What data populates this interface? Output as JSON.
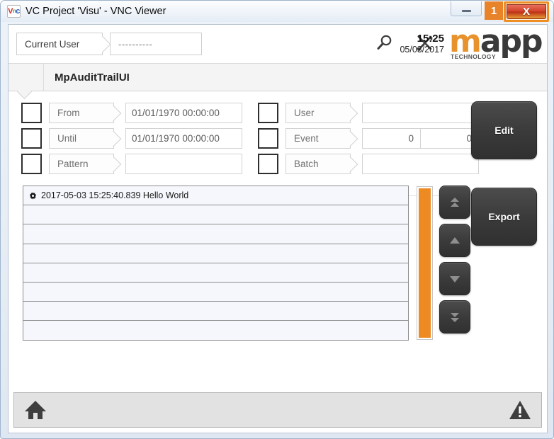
{
  "window": {
    "title": "VC Project 'Visu' - VNC Viewer",
    "logo_icon": "vnc-logo-icon",
    "logo_v": "V",
    "logo_n": "n",
    "logo_c": "c",
    "minimize_label": "minimize-icon",
    "badge_count": "1",
    "close_label": "X"
  },
  "header": {
    "current_user_label": "Current User",
    "current_user_value": "----------",
    "search_icon": "magnifier-icon",
    "tools_icon": "tools-icon",
    "time": "15:25",
    "date": "05/03/2017",
    "brand": {
      "m": "m",
      "app": "app",
      "tagline": "TECHNOLOGY",
      "accent_color": "#e8922e",
      "text_color": "#3a3a3a"
    }
  },
  "page": {
    "title": "MpAuditTrailUI"
  },
  "filters": {
    "left": [
      {
        "label": "From",
        "value": "01/01/1970 00:00:00",
        "checked": false,
        "type": "date"
      },
      {
        "label": "Until",
        "value": "01/01/1970 00:00:00",
        "checked": false,
        "type": "date"
      },
      {
        "label": "Pattern",
        "value": "",
        "checked": false,
        "type": "text"
      }
    ],
    "right": [
      {
        "label": "User",
        "value": "",
        "checked": false,
        "type": "text"
      },
      {
        "label": "Event",
        "value_from": "0",
        "value_to": "0",
        "checked": false,
        "type": "range"
      },
      {
        "label": "Batch",
        "value": "",
        "checked": false,
        "type": "text"
      }
    ],
    "edit_button": "Edit"
  },
  "list": {
    "rows": [
      {
        "icon": "gear-icon",
        "text": "2017-05-03 15:25:40.839 Hello World"
      },
      {
        "icon": "",
        "text": ""
      },
      {
        "icon": "",
        "text": ""
      },
      {
        "icon": "",
        "text": ""
      },
      {
        "icon": "",
        "text": ""
      },
      {
        "icon": "",
        "text": ""
      },
      {
        "icon": "",
        "text": ""
      },
      {
        "icon": "",
        "text": ""
      }
    ],
    "scrollbar_color": "#ed8b22",
    "nav_buttons": [
      {
        "name": "scroll-top-button",
        "icon": "double-up-arrow-icon"
      },
      {
        "name": "scroll-up-button",
        "icon": "up-arrow-icon"
      },
      {
        "name": "scroll-down-button",
        "icon": "down-arrow-icon"
      },
      {
        "name": "scroll-bottom-button",
        "icon": "double-down-arrow-icon"
      }
    ],
    "export_button": "Export"
  },
  "statusbar": {
    "home_icon": "home-icon",
    "alert_icon": "warning-triangle-icon"
  }
}
